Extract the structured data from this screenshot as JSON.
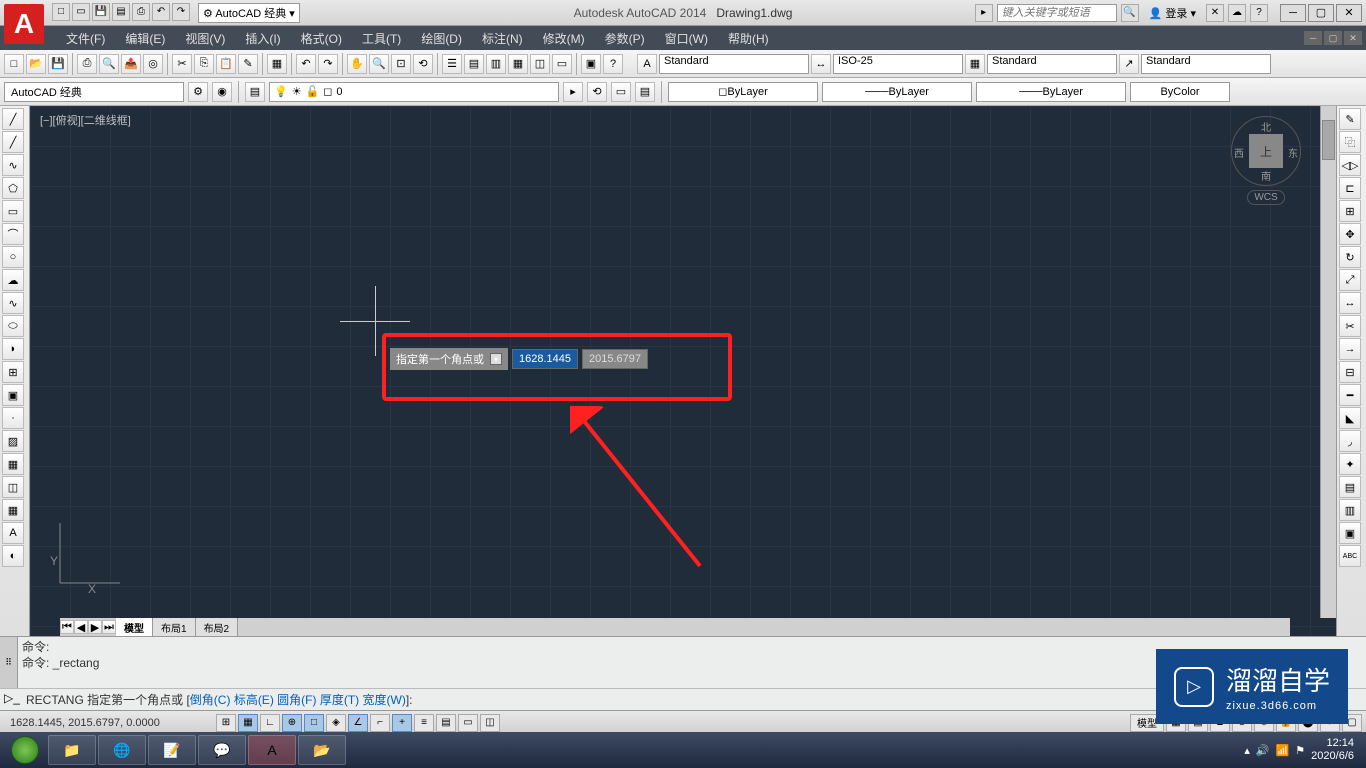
{
  "title": {
    "app": "Autodesk AutoCAD 2014",
    "file": "Drawing1.dwg"
  },
  "workspace_qat": "AutoCAD 经典",
  "search_placeholder": "键入关键字或短语",
  "login_label": "登录",
  "menu": [
    "文件(F)",
    "编辑(E)",
    "视图(V)",
    "插入(I)",
    "格式(O)",
    "工具(T)",
    "绘图(D)",
    "标注(N)",
    "修改(M)",
    "参数(P)",
    "窗口(W)",
    "帮助(H)"
  ],
  "styles": {
    "text": "Standard",
    "dim": "ISO-25",
    "table": "Standard",
    "mleader": "Standard"
  },
  "workspace_current": "AutoCAD 经典",
  "layer": {
    "current": "0"
  },
  "props": {
    "color": "ByLayer",
    "ltype": "ByLayer",
    "lweight": "ByLayer",
    "plotstyle": "ByColor"
  },
  "viewport_label": "[−][俯视][二维线框]",
  "viewcube": {
    "n": "北",
    "s": "南",
    "e": "东",
    "w": "西",
    "top": "上",
    "wcs": "WCS"
  },
  "ucs": {
    "x": "X",
    "y": "Y"
  },
  "dyn_input": {
    "label": "指定第一个角点或",
    "x": "1628.1445",
    "y": "2015.6797"
  },
  "layout_tabs": [
    "模型",
    "布局1",
    "布局2"
  ],
  "cmd_history": [
    "命令:",
    "命令: _rectang"
  ],
  "cmd_prompt": {
    "prefix": "RECTANG 指定第一个角点或 [",
    "opts": [
      "倒角(C)",
      "标高(E)",
      "圆角(F)",
      "厚度(T)",
      "宽度(W)"
    ],
    "suffix": "]:"
  },
  "status": {
    "coords": "1628.1445, 2015.6797, 0.0000",
    "model_label": "模型"
  },
  "tray": {
    "time": "12:14",
    "date": "2020/6/6"
  },
  "watermark": {
    "title": "溜溜自学",
    "sub": "zixue.3d66.com"
  }
}
